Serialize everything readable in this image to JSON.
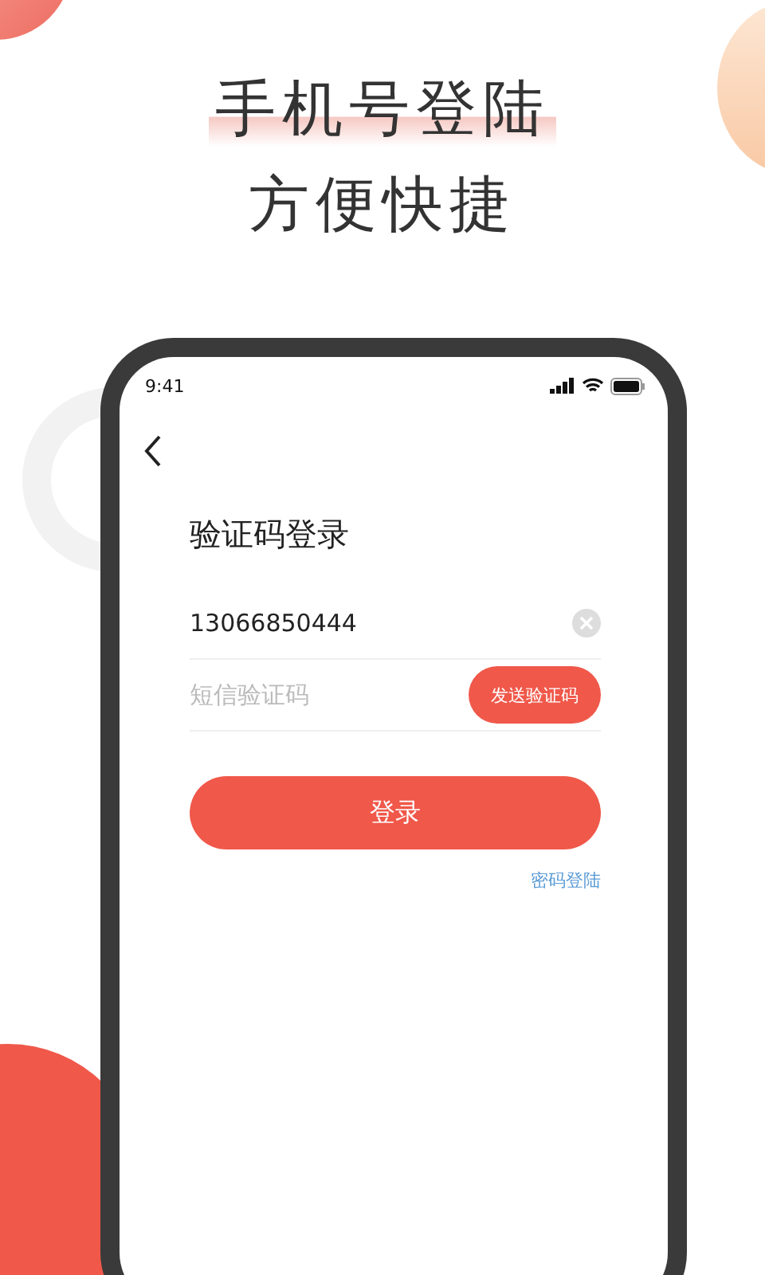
{
  "headline": {
    "line_1": "手机号登陆",
    "line_2": "方便快捷"
  },
  "status_bar": {
    "time": "9:41"
  },
  "screen": {
    "title": "验证码登录",
    "phone_field": {
      "value": "13066850444"
    },
    "code_field": {
      "placeholder": "短信验证码"
    },
    "send_code_button": "发送验证码",
    "login_button": "登录",
    "password_login_link": "密码登陆"
  }
}
